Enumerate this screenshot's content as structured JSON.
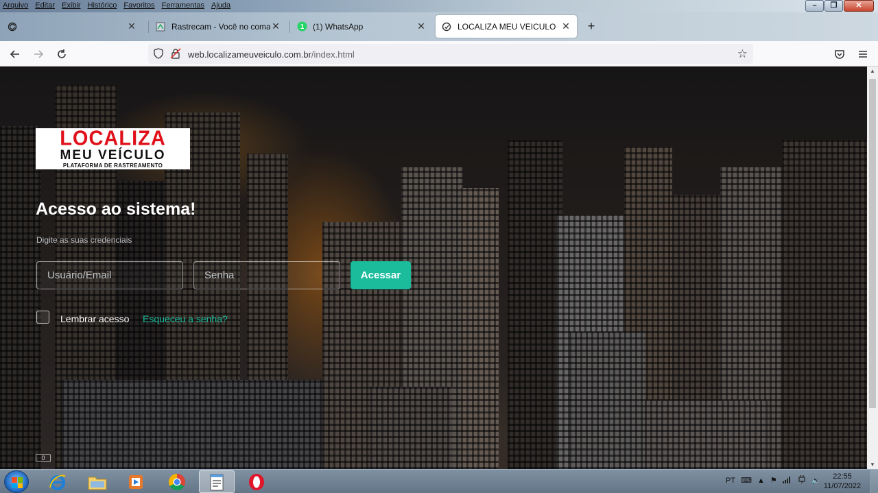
{
  "menubar": {
    "items": [
      "Arquivo",
      "Editar",
      "Exibir",
      "Histórico",
      "Favoritos",
      "Ferramentas",
      "Ajuda"
    ]
  },
  "tabs": [
    {
      "title": "",
      "icon": "firefox-sync-icon",
      "active": false
    },
    {
      "title": "Rastrecam - Você no comando",
      "icon": "rastrecam-icon",
      "active": false
    },
    {
      "title": "(1) WhatsApp",
      "icon": "whatsapp-icon",
      "badge": "1",
      "active": false
    },
    {
      "title": "LOCALIZA MEU VEICULO",
      "icon": "site-icon",
      "active": true
    }
  ],
  "nav": {
    "url_host": "web.localizameuveiculo.com.br",
    "url_path": "/index.html"
  },
  "page": {
    "logo": {
      "line1": "LOCALIZA",
      "line2": "MEU VEÍCULO",
      "line3": "PLATAFORMA DE RASTREAMENTO"
    },
    "title": "Acesso ao sistema!",
    "subtitle": "Digite as suas credenciais",
    "username_placeholder": "Usuário/Email",
    "password_placeholder": "Senha",
    "submit_label": "Acessar",
    "remember_label": "Lembrar acesso",
    "forgot_label": "Esqueceu a senha?",
    "accent_color": "#1abc9c"
  },
  "taskbar": {
    "apps": [
      "internet-explorer-icon",
      "file-explorer-icon",
      "media-player-icon",
      "chrome-icon",
      "notepad-icon",
      "opera-icon"
    ],
    "language": "PT",
    "time": "22:55",
    "date": "11/07/2022"
  }
}
